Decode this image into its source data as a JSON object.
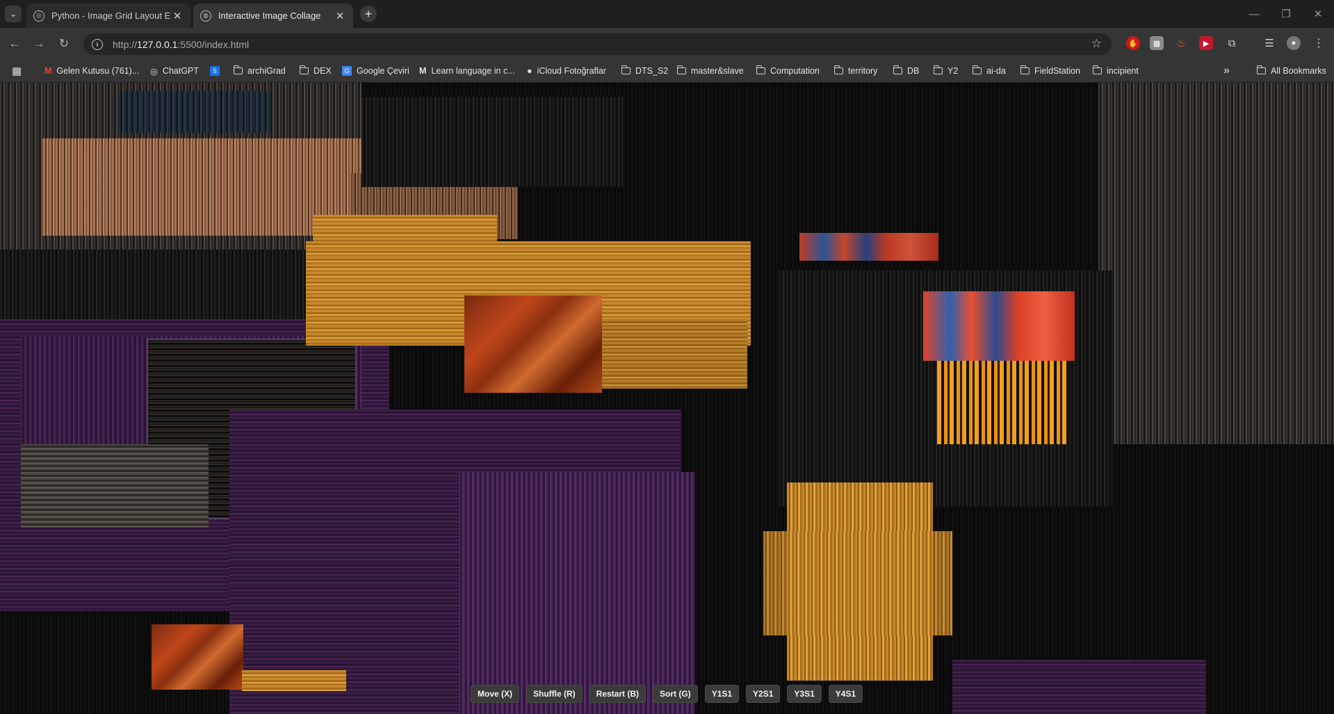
{
  "browser": {
    "tabs": [
      {
        "title": "Python - Image Grid Layout En",
        "active": false
      },
      {
        "title": "Interactive Image Collage",
        "active": true
      }
    ],
    "url_prefix": "http://",
    "url_host": "127.0.0.1",
    "url_path": ":5500/index.html",
    "bookmarks": [
      {
        "label": "Gelen Kutusu (761)...",
        "icon": "gmail-icon"
      },
      {
        "label": "ChatGPT",
        "icon": "chatgpt-icon"
      },
      {
        "label": "",
        "icon": "calendar-icon"
      },
      {
        "label": "archiGrad",
        "icon": "folder-icon"
      },
      {
        "label": "DEX",
        "icon": "folder-icon"
      },
      {
        "label": "Google Çeviri",
        "icon": "translate-icon"
      },
      {
        "label": "Learn language in c...",
        "icon": "m-icon"
      },
      {
        "label": "iCloud Fotoğraflar",
        "icon": "apple-icon"
      },
      {
        "label": "DTS_S2",
        "icon": "folder-icon"
      },
      {
        "label": "master&slave",
        "icon": "folder-icon"
      },
      {
        "label": "Computation",
        "icon": "folder-icon"
      },
      {
        "label": "territory",
        "icon": "folder-icon"
      },
      {
        "label": "DB",
        "icon": "folder-icon"
      },
      {
        "label": "Y2",
        "icon": "folder-icon"
      },
      {
        "label": "ai-da",
        "icon": "folder-icon"
      },
      {
        "label": "FieldStation",
        "icon": "folder-icon"
      },
      {
        "label": "incipient",
        "icon": "folder-icon"
      }
    ],
    "all_bookmarks": "All Bookmarks",
    "overflow": "»"
  },
  "controls": {
    "move": "Move (X)",
    "shuffle": "Shuffle (R)",
    "restart": "Restart (B)",
    "sort": "Sort (G)",
    "y1s1": "Y1S1",
    "y2s1": "Y2S1",
    "y3s1": "Y3S1",
    "y4s1": "Y4S1"
  },
  "colors": {
    "gold": "#c8892a",
    "purple": "#3a1e45",
    "background": "#070707"
  }
}
